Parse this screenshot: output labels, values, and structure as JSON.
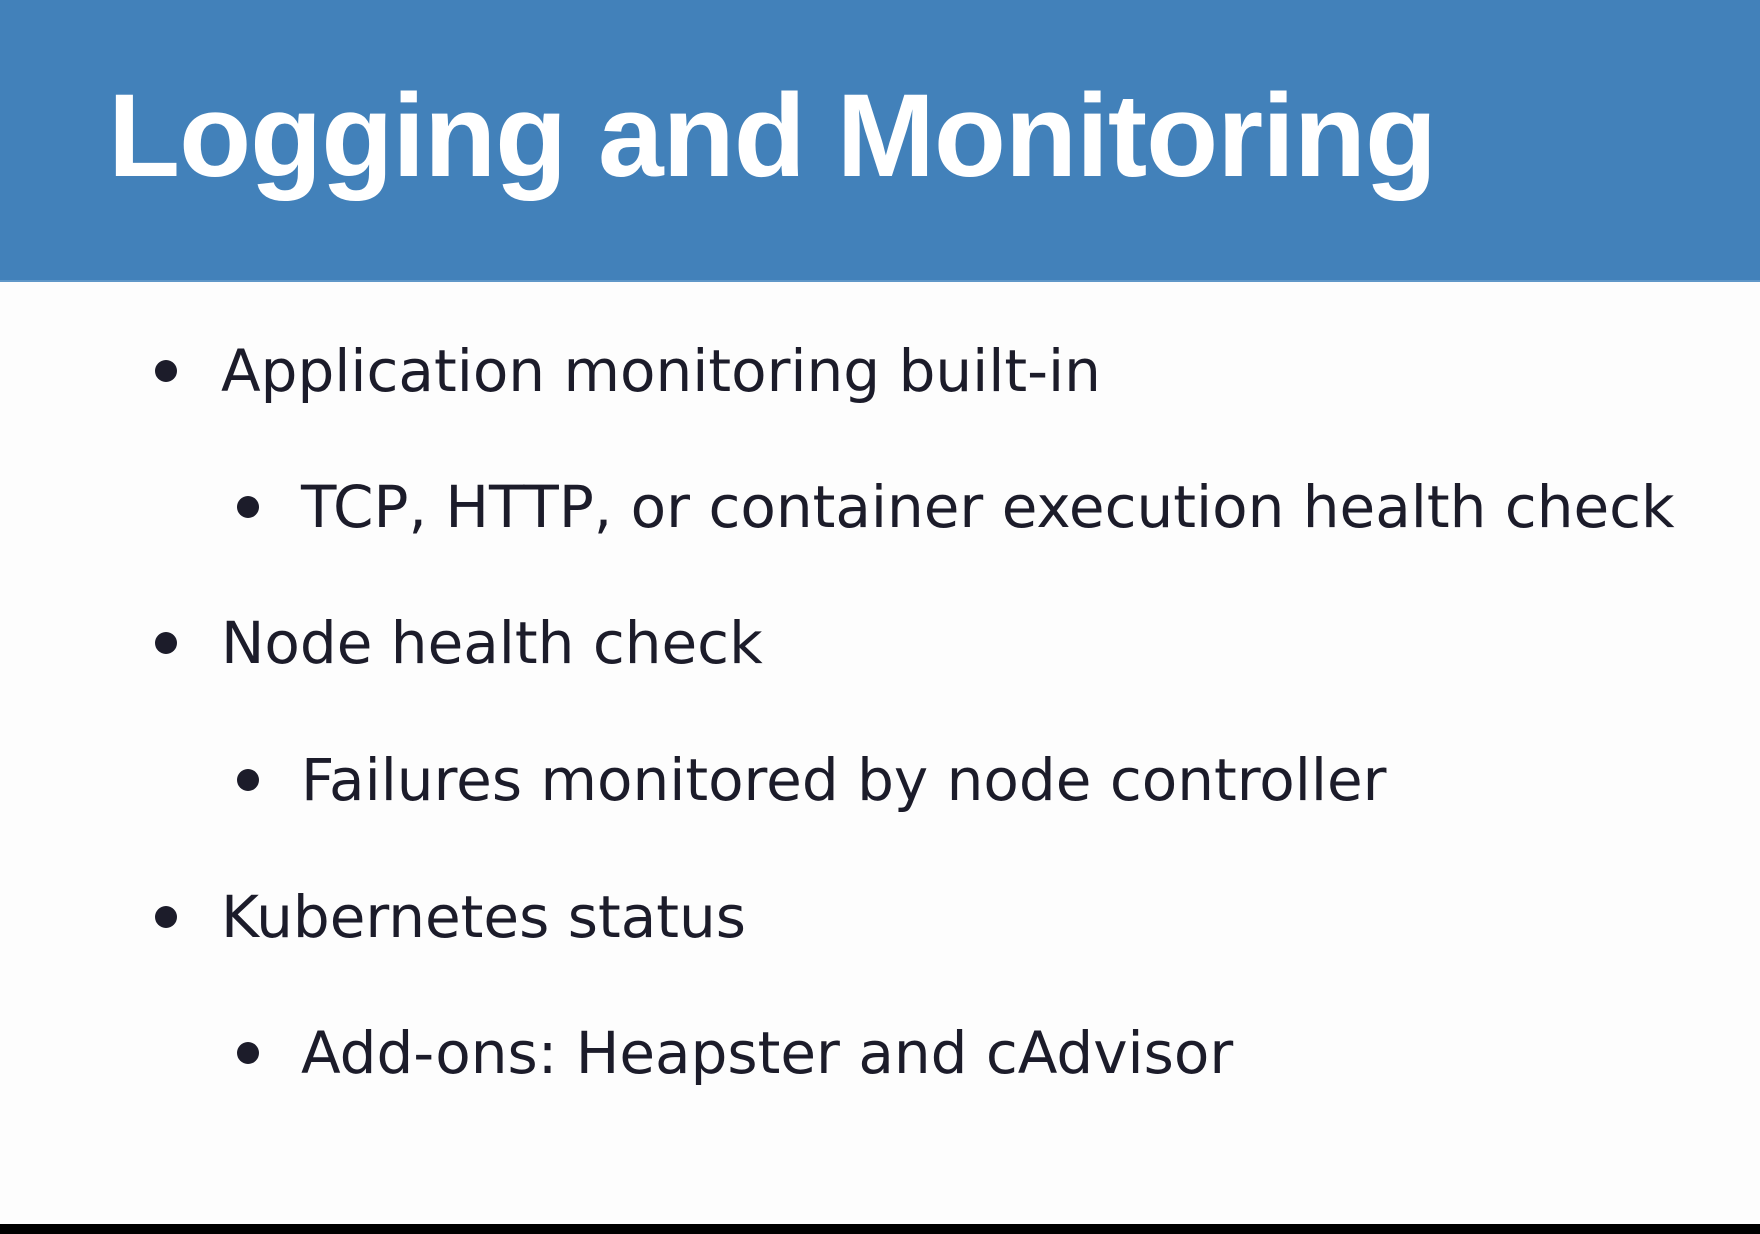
{
  "slide": {
    "title": "Logging and Monitoring",
    "header_color": "#4281ba",
    "background_color": "#fdfdfd",
    "text_color": "#1c1c2a",
    "bullets": [
      {
        "level": 1,
        "text": "Application monitoring built-in"
      },
      {
        "level": 2,
        "text": "TCP, HTTP, or container execution health check"
      },
      {
        "level": 1,
        "text": "Node health check"
      },
      {
        "level": 2,
        "text": "Failures monitored by node controller"
      },
      {
        "level": 1,
        "text": "Kubernetes status"
      },
      {
        "level": 2,
        "text": "Add-ons: Heapster and cAdvisor"
      }
    ]
  }
}
